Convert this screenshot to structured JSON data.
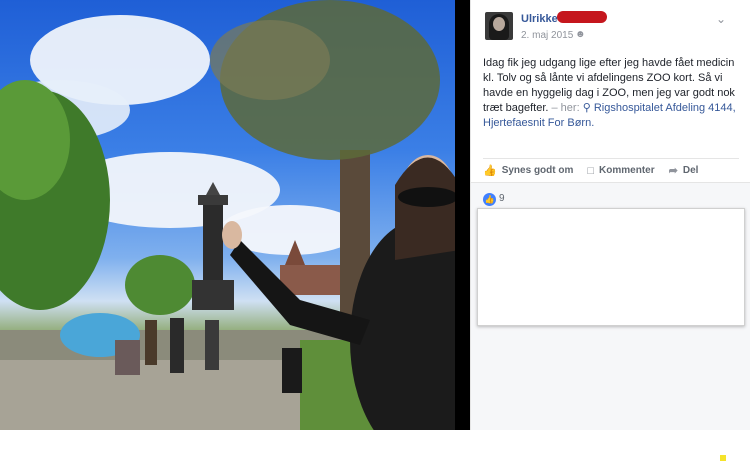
{
  "post": {
    "author_name": "Ulrikke",
    "date": "2. maj 2015",
    "audience_icon": "friends-icon",
    "body": "Idag fik jeg udgang lige efter jeg havde fået medicin kl. Tolv og så lånte vi afdelingens ZOO kort. Så vi havde en hyggelig dag i ZOO, men jeg var godt nok træt bagefter.",
    "location_prefix": "– her:",
    "location": "Rigshospitalet Afdeling 4144, Hjertefaesnit For Børn."
  },
  "actions": {
    "like_label": "Synes godt om",
    "comment_label": "Kommenter",
    "share_label": "Del"
  },
  "reactions": {
    "like_count": "9"
  },
  "colors": {
    "link": "#365899",
    "like_blue": "#4080ff",
    "muted": "#90949c",
    "redaction": "#c5161d"
  }
}
